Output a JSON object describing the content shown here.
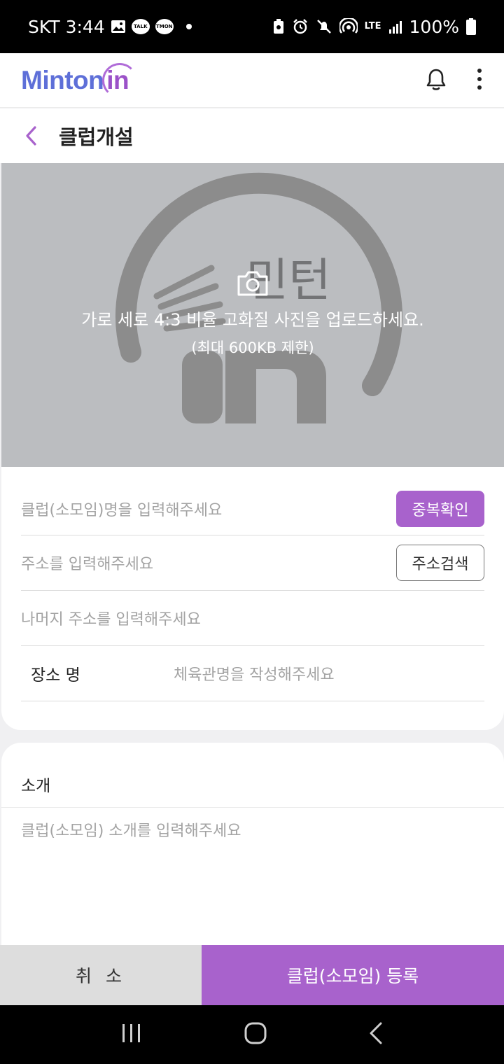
{
  "status_bar": {
    "carrier": "SKT",
    "time": "3:44",
    "talk_badge": "TALK",
    "tmon_badge": "TMON",
    "network": "LTE",
    "battery": "100%"
  },
  "header": {
    "logo_main": "Minton",
    "logo_suffix": "in"
  },
  "title_bar": {
    "title": "클럽개설"
  },
  "photo": {
    "watermark": "민턴",
    "guide": "가로 세로 4:3 비율 고화질 사진을 업로드하세요.",
    "limit": "(최대 600KB 제한)"
  },
  "form": {
    "club_name_placeholder": "클럽(소모임)명을 입력해주세요",
    "dup_check_label": "중복확인",
    "address_placeholder": "주소를 입력해주세요",
    "address_search_label": "주소검색",
    "address_detail_placeholder": "나머지 주소를 입력해주세요",
    "venue_label": "장소 명",
    "venue_placeholder": "체육관명을 작성해주세요"
  },
  "intro": {
    "label": "소개",
    "placeholder": "클럽(소모임) 소개를 입력해주세요"
  },
  "actions": {
    "cancel_label": "취 소",
    "register_label": "클럽(소모임) 등록"
  },
  "colors": {
    "accent": "#a862cc",
    "logo_blue": "#5e6fd8",
    "photo_bg": "#bbbdc0"
  }
}
